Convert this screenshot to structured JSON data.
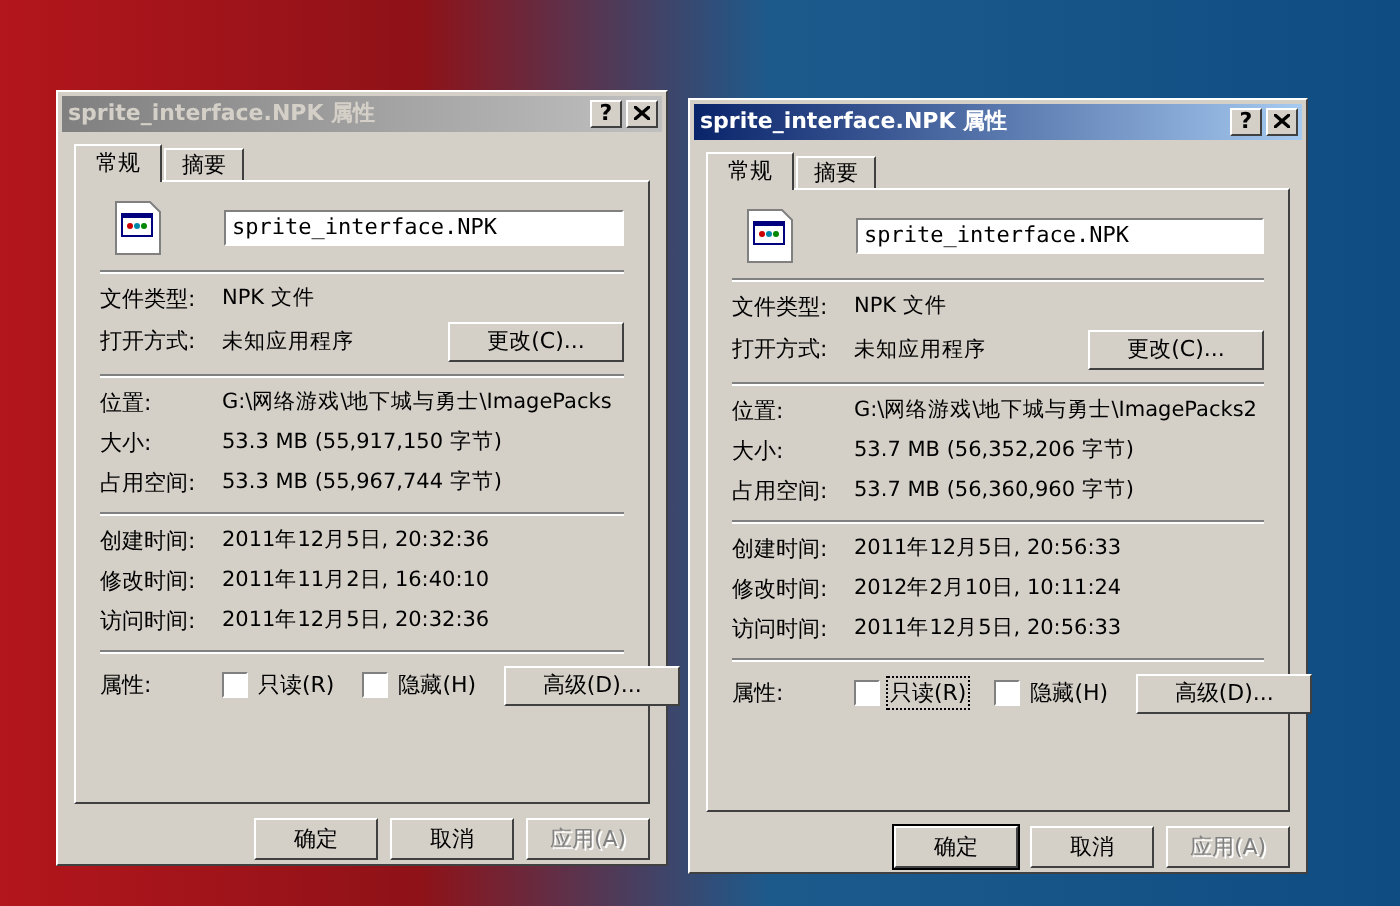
{
  "windows": [
    {
      "title": "sprite_interface.NPK 属性",
      "active": false,
      "help_button": "?",
      "tabs": [
        {
          "label": "常规",
          "selected": true
        },
        {
          "label": "摘要",
          "selected": false
        }
      ],
      "filename": "sprite_interface.NPK",
      "groups": [
        [
          {
            "label": "文件类型:",
            "value": "NPK 文件"
          },
          {
            "label": "打开方式:",
            "value": "未知应用程序",
            "button": "更改(C)..."
          }
        ],
        [
          {
            "label": "位置:",
            "value": "G:\\网络游戏\\地下城与勇士\\ImagePacks"
          },
          {
            "label": "大小:",
            "value": "53.3 MB (55,917,150 字节)"
          },
          {
            "label": "占用空间:",
            "value": "53.3 MB (55,967,744 字节)"
          }
        ],
        [
          {
            "label": "创建时间:",
            "value": "2011年12月5日, 20:32:36"
          },
          {
            "label": "修改时间:",
            "value": "2011年11月2日, 16:40:10"
          },
          {
            "label": "访问时间:",
            "value": "2011年12月5日, 20:32:36"
          }
        ]
      ],
      "attributes": {
        "label": "属性:",
        "checkboxes": [
          {
            "label": "只读(R)",
            "checked": false,
            "focused": false
          },
          {
            "label": "隐藏(H)",
            "checked": false,
            "focused": false
          }
        ],
        "button": "高级(D)..."
      },
      "buttons": [
        {
          "label": "确定",
          "disabled": false,
          "default": false
        },
        {
          "label": "取消",
          "disabled": false,
          "default": false
        },
        {
          "label": "应用(A)",
          "disabled": true,
          "default": false
        }
      ]
    },
    {
      "title": "sprite_interface.NPK 属性",
      "active": true,
      "help_button": "?",
      "tabs": [
        {
          "label": "常规",
          "selected": true
        },
        {
          "label": "摘要",
          "selected": false
        }
      ],
      "filename": "sprite_interface.NPK",
      "groups": [
        [
          {
            "label": "文件类型:",
            "value": "NPK 文件"
          },
          {
            "label": "打开方式:",
            "value": "未知应用程序",
            "button": "更改(C)..."
          }
        ],
        [
          {
            "label": "位置:",
            "value": "G:\\网络游戏\\地下城与勇士\\ImagePacks2"
          },
          {
            "label": "大小:",
            "value": "53.7 MB (56,352,206 字节)"
          },
          {
            "label": "占用空间:",
            "value": "53.7 MB (56,360,960 字节)"
          }
        ],
        [
          {
            "label": "创建时间:",
            "value": "2011年12月5日, 20:56:33"
          },
          {
            "label": "修改时间:",
            "value": "2012年2月10日, 10:11:24"
          },
          {
            "label": "访问时间:",
            "value": "2011年12月5日, 20:56:33"
          }
        ]
      ],
      "attributes": {
        "label": "属性:",
        "checkboxes": [
          {
            "label": "只读(R)",
            "checked": false,
            "focused": true
          },
          {
            "label": "隐藏(H)",
            "checked": false,
            "focused": false
          }
        ],
        "button": "高级(D)..."
      },
      "buttons": [
        {
          "label": "确定",
          "disabled": false,
          "default": true
        },
        {
          "label": "取消",
          "disabled": false,
          "default": false
        },
        {
          "label": "应用(A)",
          "disabled": true,
          "default": false
        }
      ]
    }
  ]
}
